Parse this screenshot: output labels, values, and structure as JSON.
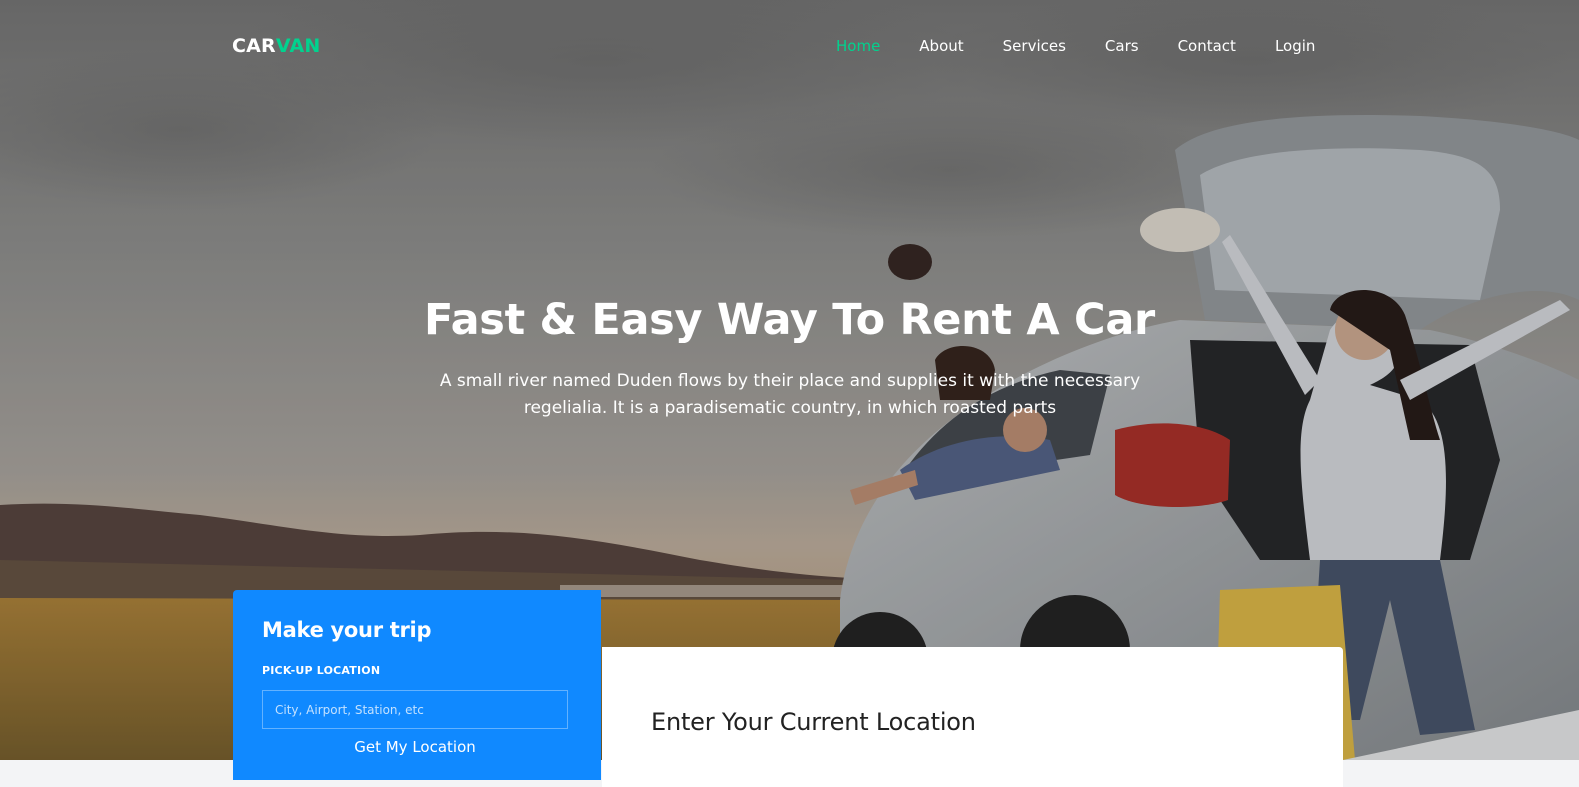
{
  "brand": {
    "part1": "CAR",
    "part2": "VAN"
  },
  "nav": {
    "items": [
      {
        "label": "Home",
        "active": true
      },
      {
        "label": "About",
        "active": false
      },
      {
        "label": "Services",
        "active": false
      },
      {
        "label": "Cars",
        "active": false
      },
      {
        "label": "Contact",
        "active": false
      },
      {
        "label": "Login",
        "active": false
      }
    ]
  },
  "hero": {
    "title": "Fast & Easy Way To Rent A Car",
    "subtitle": "A small river named Duden flows by their place and supplies it with the necessary regelialia. It is a paradisematic country, in which roasted parts"
  },
  "trip_form": {
    "title": "Make your trip",
    "pickup_label": "PICK-UP LOCATION",
    "pickup_placeholder": "City, Airport, Station, etc",
    "pickup_value": "",
    "locate_button": "Get My Location"
  },
  "location_panel": {
    "title": "Enter Your Current Location"
  },
  "colors": {
    "accent": "#01d28e",
    "primary_blue": "#1089ff",
    "text_dark": "#222222",
    "white": "#ffffff"
  }
}
